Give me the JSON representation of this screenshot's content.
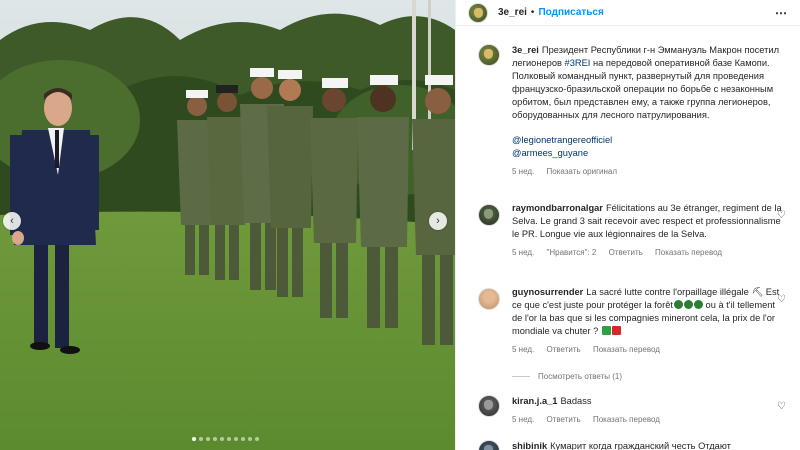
{
  "post": {
    "username": "3e_rei",
    "header_dot": "•",
    "follow_label": "Подписаться",
    "more_icon": "⋯",
    "caption": {
      "author": "3e_rei",
      "text_before": "Президент Республики г-н Эммануэль Макрон посетил легионеров",
      "hashtag": "#3REI",
      "text_after": "на передовой оперативной базе Камопи. Полковый командный пункт, развернутый для проведения французско-бразильской операции по борьбе с незаконным орбитом, был представлен ему, а также группа легионеров, оборудованных для лесного патрулирования.",
      "mention_1": "@legionetrangereofficiel",
      "mention_2": "@armees_guyane",
      "age": "5 нед.",
      "show_original": "Показать оригинал"
    }
  },
  "comments": [
    {
      "user": "raymondbarronalgar",
      "text": "Félicitations au 3e étranger, regiment de la Selva. Le grand 3 sait recevoir avec respect et professionnalisme le PR. Longue vie aux légionnaires de la Selva.",
      "age": "5 нед.",
      "likes": "\"Нравится\": 2",
      "reply": "Ответить",
      "translate": "Показать перевод"
    },
    {
      "user": "guynosurrender",
      "text_1": "La sacré lutte contre l'orpaillage illégale ⛏ Est ce que c'est juste pour protéger la forêt",
      "text_2": "ou à t'il tellement de l'or la bas que si les compagnies mineront cela, la prix de l'or mondiale va chuter ?",
      "age": "5 нед.",
      "reply": "Ответить",
      "translate": "Показать перевод",
      "view_replies": "Посмотреть ответы (1)"
    },
    {
      "user": "kiran.j.a_1",
      "text": "Badass",
      "age": "5 нед.",
      "reply": "Ответить",
      "translate": "Показать перевод"
    },
    {
      "user": "shibinik",
      "text": "Кумарит когда гражданский честь  Отдают"
    }
  ],
  "icons": {
    "heart": "♡",
    "arrow_left": "‹",
    "arrow_right": "›"
  },
  "colors": {
    "follow_blue": "#0095f6",
    "link_blue": "#00376b",
    "meta_gray": "#737373"
  }
}
